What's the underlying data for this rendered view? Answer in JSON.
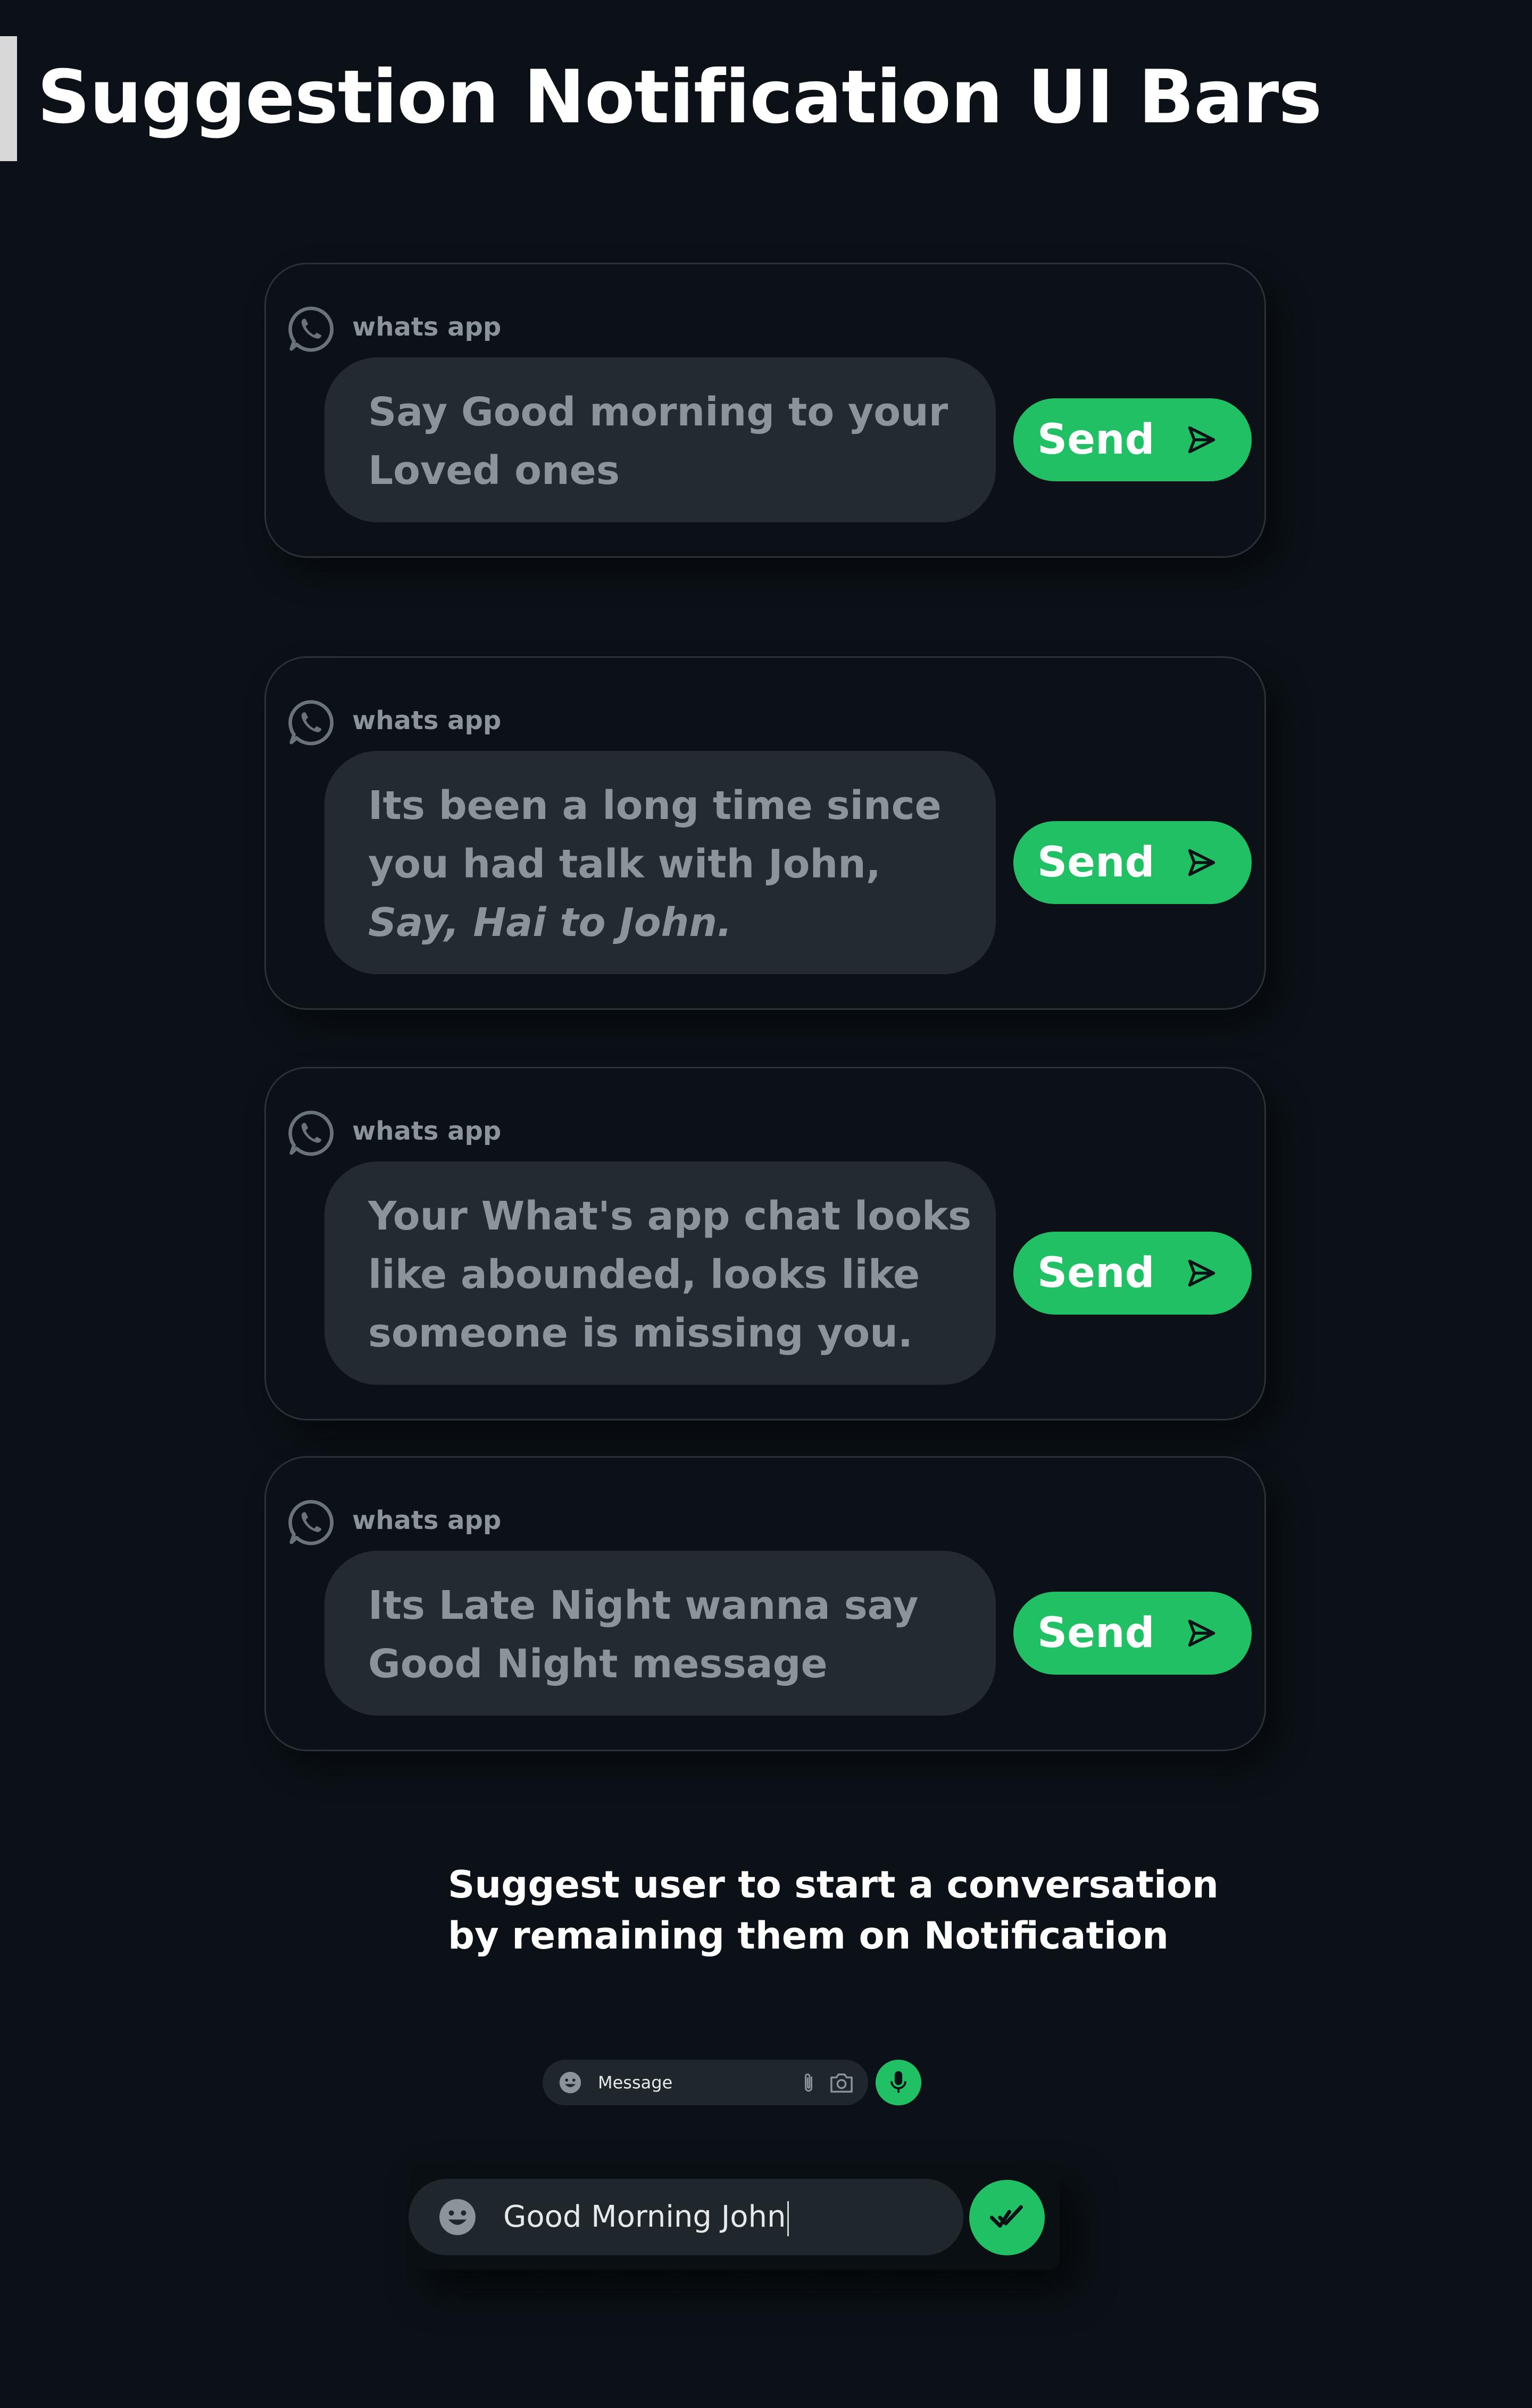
{
  "page": {
    "title": "Suggestion Notification UI Bars"
  },
  "theme": {
    "background": "#0b1117",
    "card_border": "#2a3138",
    "bubble_bg": "#242a31",
    "muted_text": "#8b949b",
    "accent": "#22c064",
    "title_text": "#ffffff"
  },
  "cards": [
    {
      "app_label": "whats app",
      "app_icon": "whatsapp-icon",
      "message_parts": [
        {
          "text": "Say Good morning to your Loved ones",
          "italic": false
        }
      ],
      "send_label": "Send",
      "send_icon": "send-arrow-icon"
    },
    {
      "app_label": "whats app",
      "app_icon": "whatsapp-icon",
      "message_parts": [
        {
          "text": "Its been a long time since you had talk with John, ",
          "italic": false
        },
        {
          "text": "Say, Hai to John.",
          "italic": true
        }
      ],
      "send_label": "Send",
      "send_icon": "send-arrow-icon"
    },
    {
      "app_label": "whats app",
      "app_icon": "whatsapp-icon",
      "message_parts": [
        {
          "text": "Your What's app chat looks like abounded, looks like someone is missing you.",
          "italic": false
        }
      ],
      "send_label": "Send",
      "send_icon": "send-arrow-icon"
    },
    {
      "app_label": "whats app",
      "app_icon": "whatsapp-icon",
      "message_parts": [
        {
          "text": "Its Late Night wanna say Good Night message",
          "italic": false
        }
      ],
      "send_label": "Send",
      "send_icon": "send-arrow-icon"
    }
  ],
  "caption": {
    "line1": "Suggest user to start a conversation",
    "line2": "by remaining them on Notification"
  },
  "mini_composer": {
    "placeholder": "Message",
    "icons": [
      "emoji-icon",
      "paperclip-icon",
      "camera-icon",
      "microphone-icon"
    ]
  },
  "composer": {
    "value": "Good Morning John",
    "icons": [
      "emoji-icon",
      "checkmark-icon"
    ]
  }
}
